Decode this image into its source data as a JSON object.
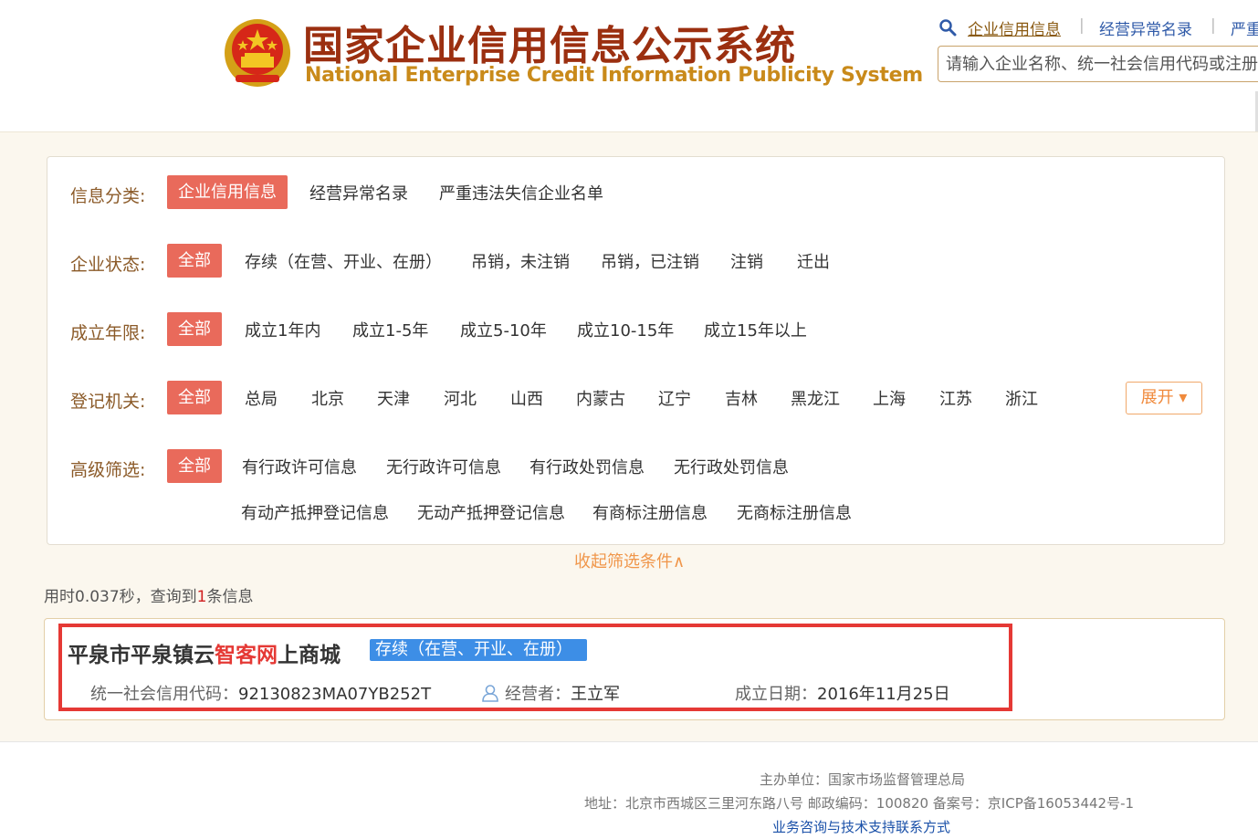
{
  "header": {
    "title_cn": "国家企业信用信息公示系统",
    "title_en": "National Enterprise Credit Information Publicity System",
    "nav": {
      "credit_info": "企业信用信息",
      "sep": "|",
      "abnormal_list": "经营异常名录",
      "serious_violation": "严重"
    },
    "search_placeholder": "请输入企业名称、统一社会信用代码或注册号"
  },
  "filters": {
    "category": {
      "label": "信息分类:",
      "options": [
        "企业信用信息",
        "经营异常名录",
        "严重违法失信企业名单"
      ],
      "active_index": 0
    },
    "status": {
      "label": "企业状态:",
      "options": [
        "全部",
        "存续（在营、开业、在册）",
        "吊销，未注销",
        "吊销，已注销",
        "注销",
        "迁出"
      ],
      "active_index": 0
    },
    "years": {
      "label": "成立年限:",
      "options": [
        "全部",
        "成立1年内",
        "成立1-5年",
        "成立5-10年",
        "成立10-15年",
        "成立15年以上"
      ],
      "active_index": 0
    },
    "authority": {
      "label": "登记机关:",
      "options": [
        "全部",
        "总局",
        "北京",
        "天津",
        "河北",
        "山西",
        "内蒙古",
        "辽宁",
        "吉林",
        "黑龙江",
        "上海",
        "江苏",
        "浙江"
      ],
      "active_index": 0,
      "expand_label": "展开 ▾"
    },
    "advanced": {
      "label": "高级筛选:",
      "options_row1": [
        "全部",
        "有行政许可信息",
        "无行政许可信息",
        "有行政处罚信息",
        "无行政处罚信息"
      ],
      "options_row2": [
        "有动产抵押登记信息",
        "无动产抵押登记信息",
        "有商标注册信息",
        "无商标注册信息"
      ],
      "active_index": 0
    },
    "collapse_label": "收起筛选条件∧"
  },
  "result_stats": {
    "prefix": "用时0.037秒，查询到",
    "count": "1",
    "suffix": "条信息"
  },
  "result": {
    "name_part1": "平泉市平泉镇云",
    "name_highlight": "智客网",
    "name_part2": "上商城",
    "status": "存续（在营、开业、在册）",
    "credit_code_label": "统一社会信用代码：",
    "credit_code": "92130823MA07YB252T",
    "operator_label": "经营者：",
    "operator": "王立军",
    "date_label": "成立日期：",
    "date": "2016年11月25日"
  },
  "footer": {
    "sponsor": "主办单位：国家市场监督管理总局",
    "address": "地址：北京市西城区三里河东路八号   邮政编码：100820   备案号：京ICP备16053442号-1",
    "contact": "业务咨询与技术支持联系方式"
  },
  "colors": {
    "active_red": "#e96a5b",
    "title_brown": "#9b2f10",
    "title_gold": "#c98a1a",
    "status_blue": "#3d8ee6",
    "highlight_red": "#e53935"
  }
}
